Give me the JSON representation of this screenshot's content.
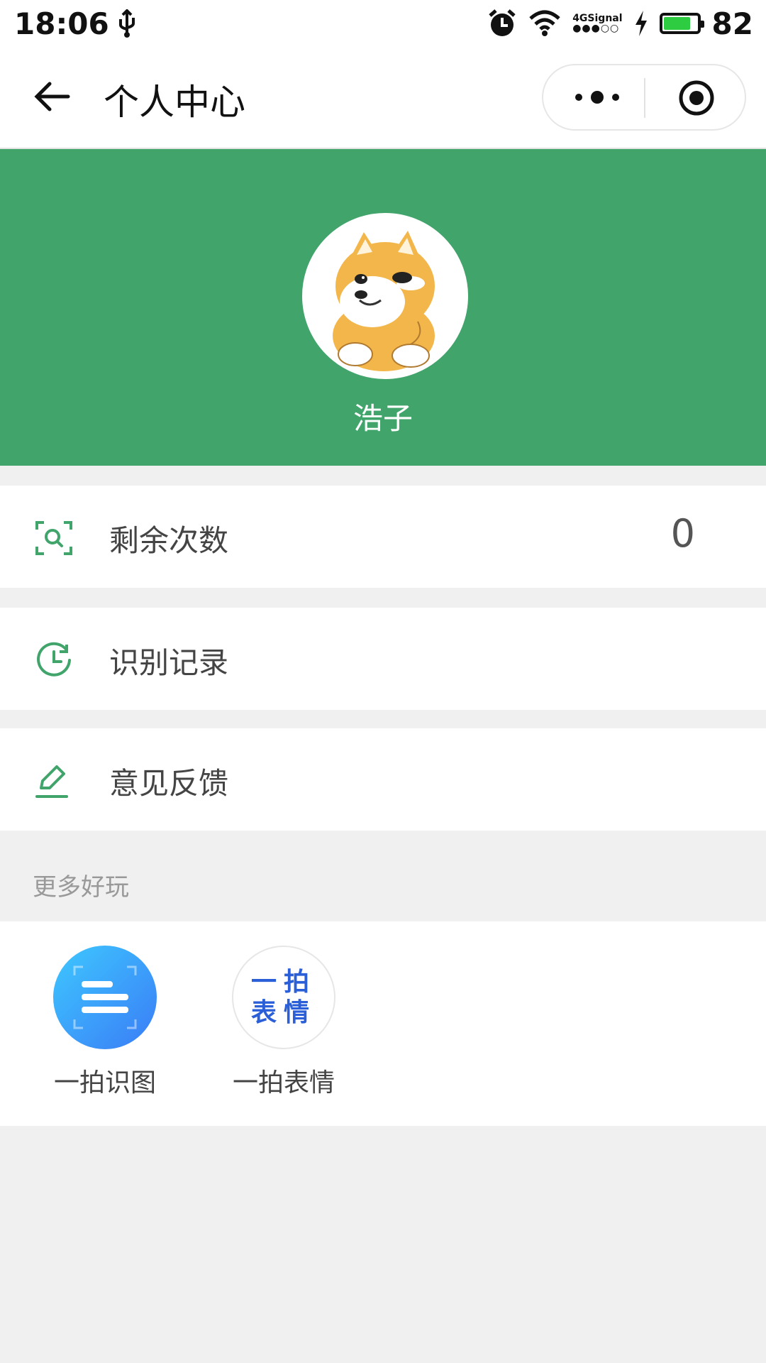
{
  "status_bar": {
    "time": "18:06",
    "network": "4G",
    "signal_label": "Signal",
    "battery_percent": "82",
    "battery_level": 0.82
  },
  "nav": {
    "title": "个人中心"
  },
  "profile": {
    "username": "浩子",
    "brand_color": "#40a46b"
  },
  "menu": {
    "remaining": {
      "label": "剩余次数",
      "value": "0"
    },
    "history": {
      "label": "识别记录"
    },
    "feedback": {
      "label": "意见反馈"
    }
  },
  "more": {
    "title": "更多好玩",
    "apps": [
      {
        "name": "一拍识图"
      },
      {
        "name": "一拍表情",
        "icon_text_line1": "一拍",
        "icon_text_line2": "表情"
      }
    ]
  }
}
